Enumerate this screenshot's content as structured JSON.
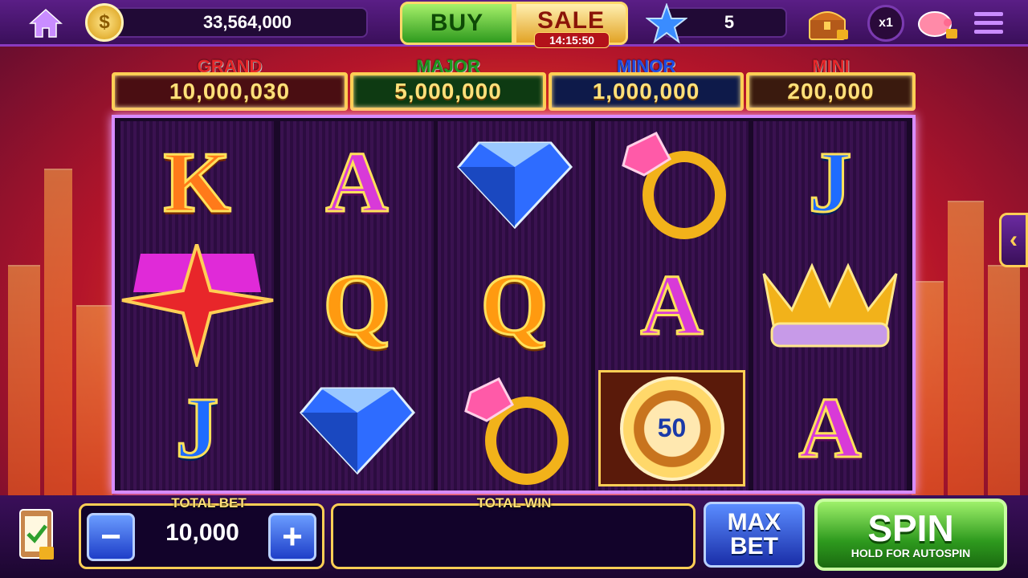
{
  "topbar": {
    "coins": "33,564,000",
    "buy_label": "BUY",
    "sale_label": "SALE",
    "sale_timer": "14:15:50",
    "stars": "5",
    "multiplier": "x1"
  },
  "jackpots": [
    {
      "label": "GRAND",
      "value": "10,000,030",
      "label_color": "#e8262a",
      "box_color": "#4a0e12"
    },
    {
      "label": "MAJOR",
      "value": "5,000,000",
      "label_color": "#1e9a1e",
      "box_color": "#0e3a12"
    },
    {
      "label": "MINOR",
      "value": "1,000,000",
      "label_color": "#1e4ae8",
      "box_color": "#0e1a4a"
    },
    {
      "label": "MINI",
      "value": "200,000",
      "label_color": "#e8262a",
      "box_color": "#3a1a0e"
    }
  ],
  "reels": [
    [
      "K",
      "wild-star",
      "J"
    ],
    [
      "A",
      "Q",
      "diamond"
    ],
    [
      "diamond",
      "Q",
      "ring"
    ],
    [
      "ring",
      "A",
      "chip"
    ],
    [
      "J",
      "crown",
      "A"
    ]
  ],
  "chip_value": "50",
  "bottombar": {
    "total_bet_label": "TOTAL BET",
    "total_bet_value": "10,000",
    "total_win_label": "TOTAL WIN",
    "total_win_value": "",
    "max_bet_line1": "MAX",
    "max_bet_line2": "BET",
    "spin_label": "SPIN",
    "spin_sub": "HOLD FOR AUTOSPIN"
  },
  "colors": {
    "accent_purple": "#5a1e86",
    "spin_green": "#2e9a1e",
    "gold": "#ffcf55"
  }
}
